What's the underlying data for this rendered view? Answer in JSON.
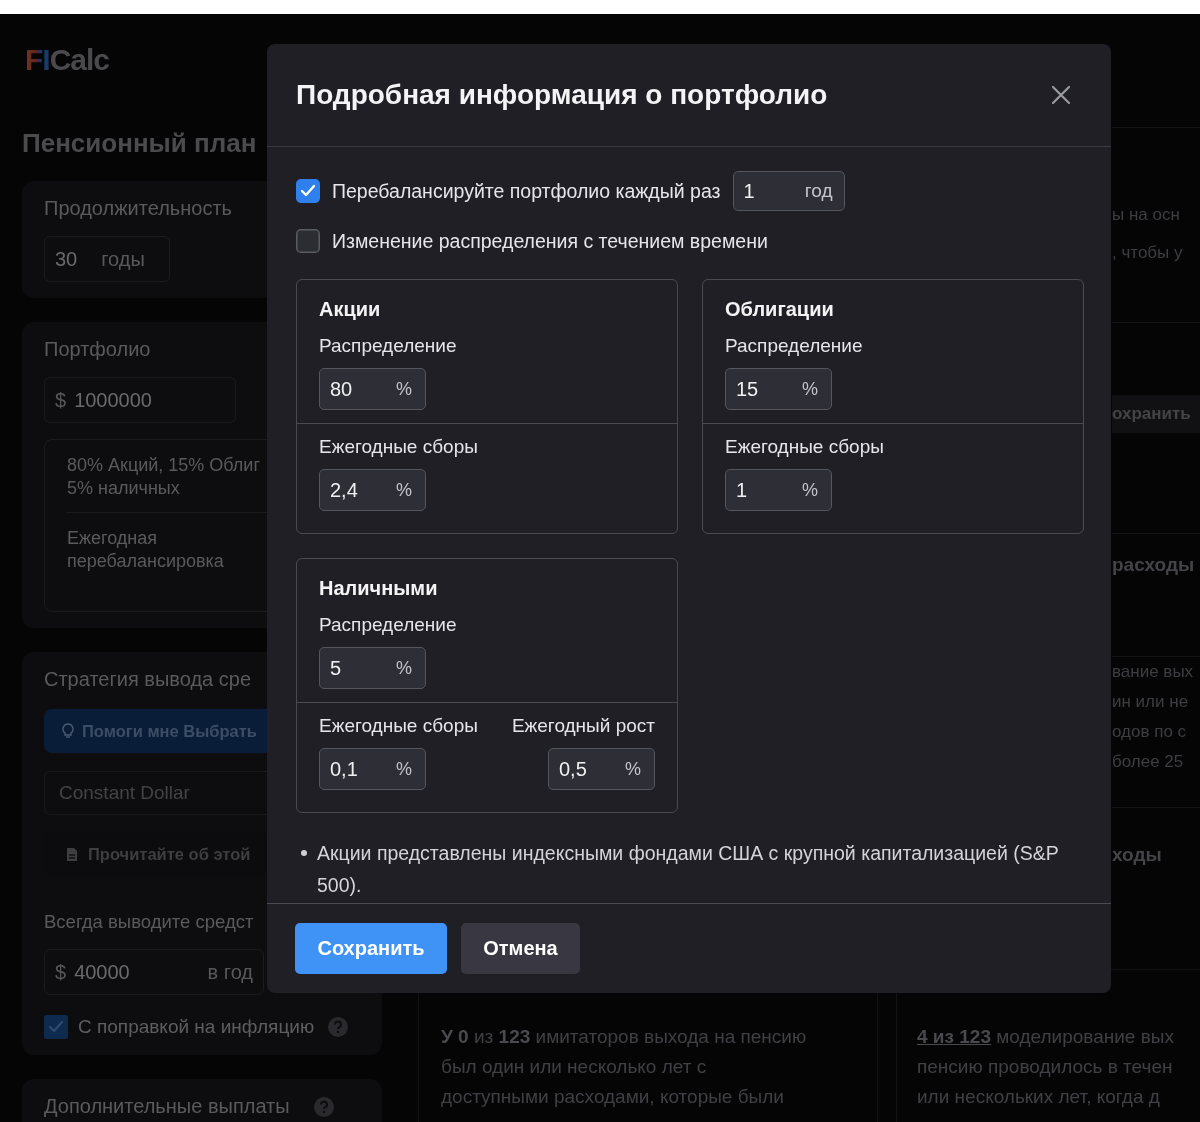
{
  "background": {
    "logo": {
      "mark": "FI",
      "name": "Calc"
    },
    "page_title": "Пенсионный план",
    "duration": {
      "title": "Продолжительность",
      "value": "30",
      "unit": "годы"
    },
    "portfolio": {
      "title": "Портфолио",
      "currency": "$",
      "value": "1000000",
      "summary": [
        "80% Акций, 15% Облиг",
        "5% наличных"
      ],
      "rebalancing": "Ежегодная перебалансировка"
    },
    "strategy": {
      "title": "Стратегия вывода сре",
      "help_button": "Помоги мне Выбрать",
      "select": "Constant Dollar",
      "read_button": "Прочитайте об этой",
      "withdraw_label": "Всегда выводите средст",
      "currency": "$",
      "value": "40000",
      "unit": "в год",
      "inflation": {
        "label": "С поправкой на инфляцию",
        "checked": true
      }
    },
    "extra_payments": {
      "title": "Дополнительные выплаты"
    },
    "side_fragments": [
      {
        "kind": "text",
        "lines": [
          "ы на осн",
          ", чтобы у"
        ]
      },
      {
        "kind": "button",
        "lines": [
          "охранить"
        ]
      },
      {
        "kind": "heading",
        "lines": [
          "расходы"
        ]
      },
      {
        "kind": "text",
        "lines": [
          "вание вых",
          "ин или не",
          "одов по с",
          "более 25"
        ]
      },
      {
        "kind": "heading",
        "lines": [
          "ходы"
        ]
      }
    ],
    "result_cards": [
      {
        "lines": [
          "**У 0** из **123** имитаторов выхода на пенсию",
          "был один или несколько лет с",
          "доступными расходами, которые были"
        ]
      },
      {
        "link": "4 из 123",
        "lines": [
          " моделирование вых",
          "пенсию проводилось в течен",
          "или нескольких лет, когда д"
        ]
      }
    ]
  },
  "modal": {
    "title": "Подробная информация о портфолио",
    "options": [
      {
        "label": "Перебалансируйте портфолио каждый раз",
        "checked": true,
        "field": {
          "value": "1",
          "unit": "год"
        }
      },
      {
        "label": "Изменение распределения с течением времени",
        "checked": false
      }
    ],
    "assets": [
      {
        "title": "Акции",
        "sections": [
          [
            {
              "label": "Распределение",
              "value": "80",
              "unit": "%"
            }
          ],
          [
            {
              "label": "Ежегодные сборы",
              "value": "2,4",
              "unit": "%"
            }
          ]
        ]
      },
      {
        "title": "Облигации",
        "sections": [
          [
            {
              "label": "Распределение",
              "value": "15",
              "unit": "%"
            }
          ],
          [
            {
              "label": "Ежегодные сборы",
              "value": "1",
              "unit": "%"
            }
          ]
        ]
      },
      {
        "title": "Наличными",
        "sections": [
          [
            {
              "label": "Распределение",
              "value": "5",
              "unit": "%"
            }
          ],
          [
            {
              "label": "Ежегодные сборы",
              "value": "0,1",
              "unit": "%"
            },
            {
              "label": "Ежегодный рост",
              "value": "0,5",
              "unit": "%"
            }
          ]
        ]
      }
    ],
    "notes": [
      "Акции представлены индексными фондами США с крупной капитализацией (S&P 500)."
    ],
    "buttons": [
      {
        "label": "Сохранить",
        "kind": "primary"
      },
      {
        "label": "Отмена",
        "kind": "secondary"
      }
    ]
  }
}
